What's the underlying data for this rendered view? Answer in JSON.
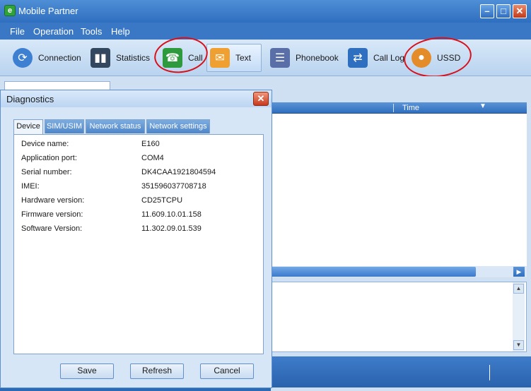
{
  "window": {
    "title": "Mobile Partner",
    "app_icon_letter": "e"
  },
  "menu": [
    "File",
    "Operation",
    "Tools",
    "Help"
  ],
  "toolbar": [
    {
      "label": "Connection",
      "icon": "connection-icon"
    },
    {
      "label": "Statistics",
      "icon": "statistics-icon"
    },
    {
      "label": "Call",
      "icon": "phone-icon"
    },
    {
      "label": "Text",
      "icon": "envelope-icon"
    },
    {
      "label": "Phonebook",
      "icon": "phonebook-icon"
    },
    {
      "label": "Call Log",
      "icon": "call-log-icon"
    },
    {
      "label": "USSD",
      "icon": "ussd-icon"
    }
  ],
  "list": {
    "time_header": "Time"
  },
  "dialog": {
    "title": "Diagnostics",
    "tabs": [
      "Device",
      "SIM/USIM",
      "Network status",
      "Network settings"
    ],
    "fields": [
      {
        "label": "Device name:",
        "value": "E160"
      },
      {
        "label": "Application port:",
        "value": "COM4"
      },
      {
        "label": "Serial number:",
        "value": "DK4CAA1921804594"
      },
      {
        "label": "IMEI:",
        "value": "351596037708718"
      },
      {
        "label": "Hardware version:",
        "value": "CD25TCPU"
      },
      {
        "label": "Firmware version:",
        "value": "11.609.10.01.158"
      },
      {
        "label": "Software Version:",
        "value": "11.302.09.01.539"
      }
    ],
    "buttons": {
      "save": "Save",
      "refresh": "Refresh",
      "cancel": "Cancel"
    }
  },
  "colors": {
    "titlebar": "#2f6fbf",
    "annotation": "#d8101a"
  }
}
